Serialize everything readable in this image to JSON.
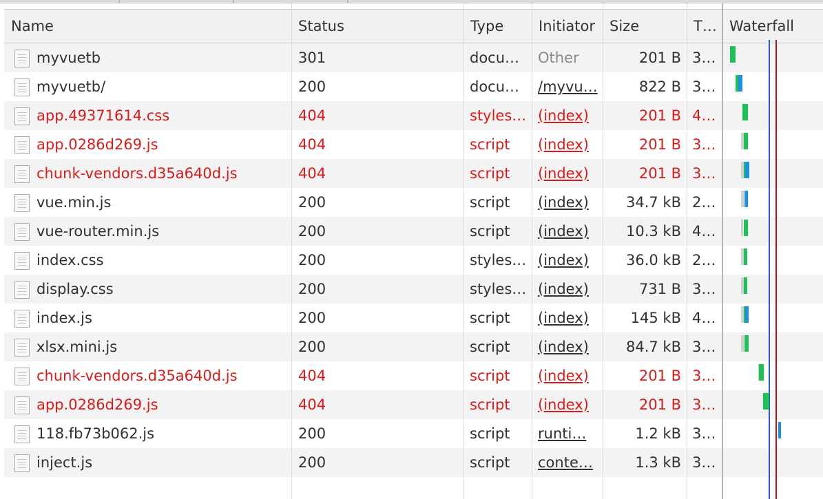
{
  "colors": {
    "error_text": "#d81b1b",
    "waiting_green": "#1fbf5a",
    "download_blue": "#1f8fe0",
    "dom_content_line": "#2462c7",
    "load_line": "#a31818"
  },
  "columns": {
    "name": "Name",
    "status": "Status",
    "type": "Type",
    "initiator": "Initiator",
    "size": "Size",
    "time": "T…",
    "waterfall": "Waterfall"
  },
  "requests": [
    {
      "name": "myvuetb",
      "status": "301",
      "type": "docu…",
      "initiator": "Other",
      "size": "201 B",
      "time": "3…",
      "error": false
    },
    {
      "name": "myvuetb/",
      "status": "200",
      "type": "docu…",
      "initiator": "/myvu…",
      "size": "822 B",
      "time": "3…",
      "error": false
    },
    {
      "name": "app.49371614.css",
      "status": "404",
      "type": "styles…",
      "initiator": "(index)",
      "size": "201 B",
      "time": "4…",
      "error": true
    },
    {
      "name": "app.0286d269.js",
      "status": "404",
      "type": "script",
      "initiator": "(index)",
      "size": "201 B",
      "time": "3…",
      "error": true
    },
    {
      "name": "chunk-vendors.d35a640d.js",
      "status": "404",
      "type": "script",
      "initiator": "(index)",
      "size": "201 B",
      "time": "3…",
      "error": true
    },
    {
      "name": "vue.min.js",
      "status": "200",
      "type": "script",
      "initiator": "(index)",
      "size": "34.7 kB",
      "time": "2…",
      "error": false
    },
    {
      "name": "vue-router.min.js",
      "status": "200",
      "type": "script",
      "initiator": "(index)",
      "size": "10.3 kB",
      "time": "4…",
      "error": false
    },
    {
      "name": "index.css",
      "status": "200",
      "type": "styles…",
      "initiator": "(index)",
      "size": "36.0 kB",
      "time": "2…",
      "error": false
    },
    {
      "name": "display.css",
      "status": "200",
      "type": "styles…",
      "initiator": "(index)",
      "size": "731 B",
      "time": "3…",
      "error": false
    },
    {
      "name": "index.js",
      "status": "200",
      "type": "script",
      "initiator": "(index)",
      "size": "145 kB",
      "time": "4…",
      "error": false
    },
    {
      "name": "xlsx.mini.js",
      "status": "200",
      "type": "script",
      "initiator": "(index)",
      "size": "84.7 kB",
      "time": "3…",
      "error": false
    },
    {
      "name": "chunk-vendors.d35a640d.js",
      "status": "404",
      "type": "script",
      "initiator": "(index)",
      "size": "201 B",
      "time": "3…",
      "error": true
    },
    {
      "name": "app.0286d269.js",
      "status": "404",
      "type": "script",
      "initiator": "(index)",
      "size": "201 B",
      "time": "3…",
      "error": true
    },
    {
      "name": "118.fb73b062.js",
      "status": "200",
      "type": "script",
      "initiator": "runti…",
      "size": "1.2 kB",
      "time": "3…",
      "error": false
    },
    {
      "name": "inject.js",
      "status": "200",
      "type": "script",
      "initiator": "conte…",
      "size": "1.3 kB",
      "time": "3…",
      "error": false
    }
  ]
}
